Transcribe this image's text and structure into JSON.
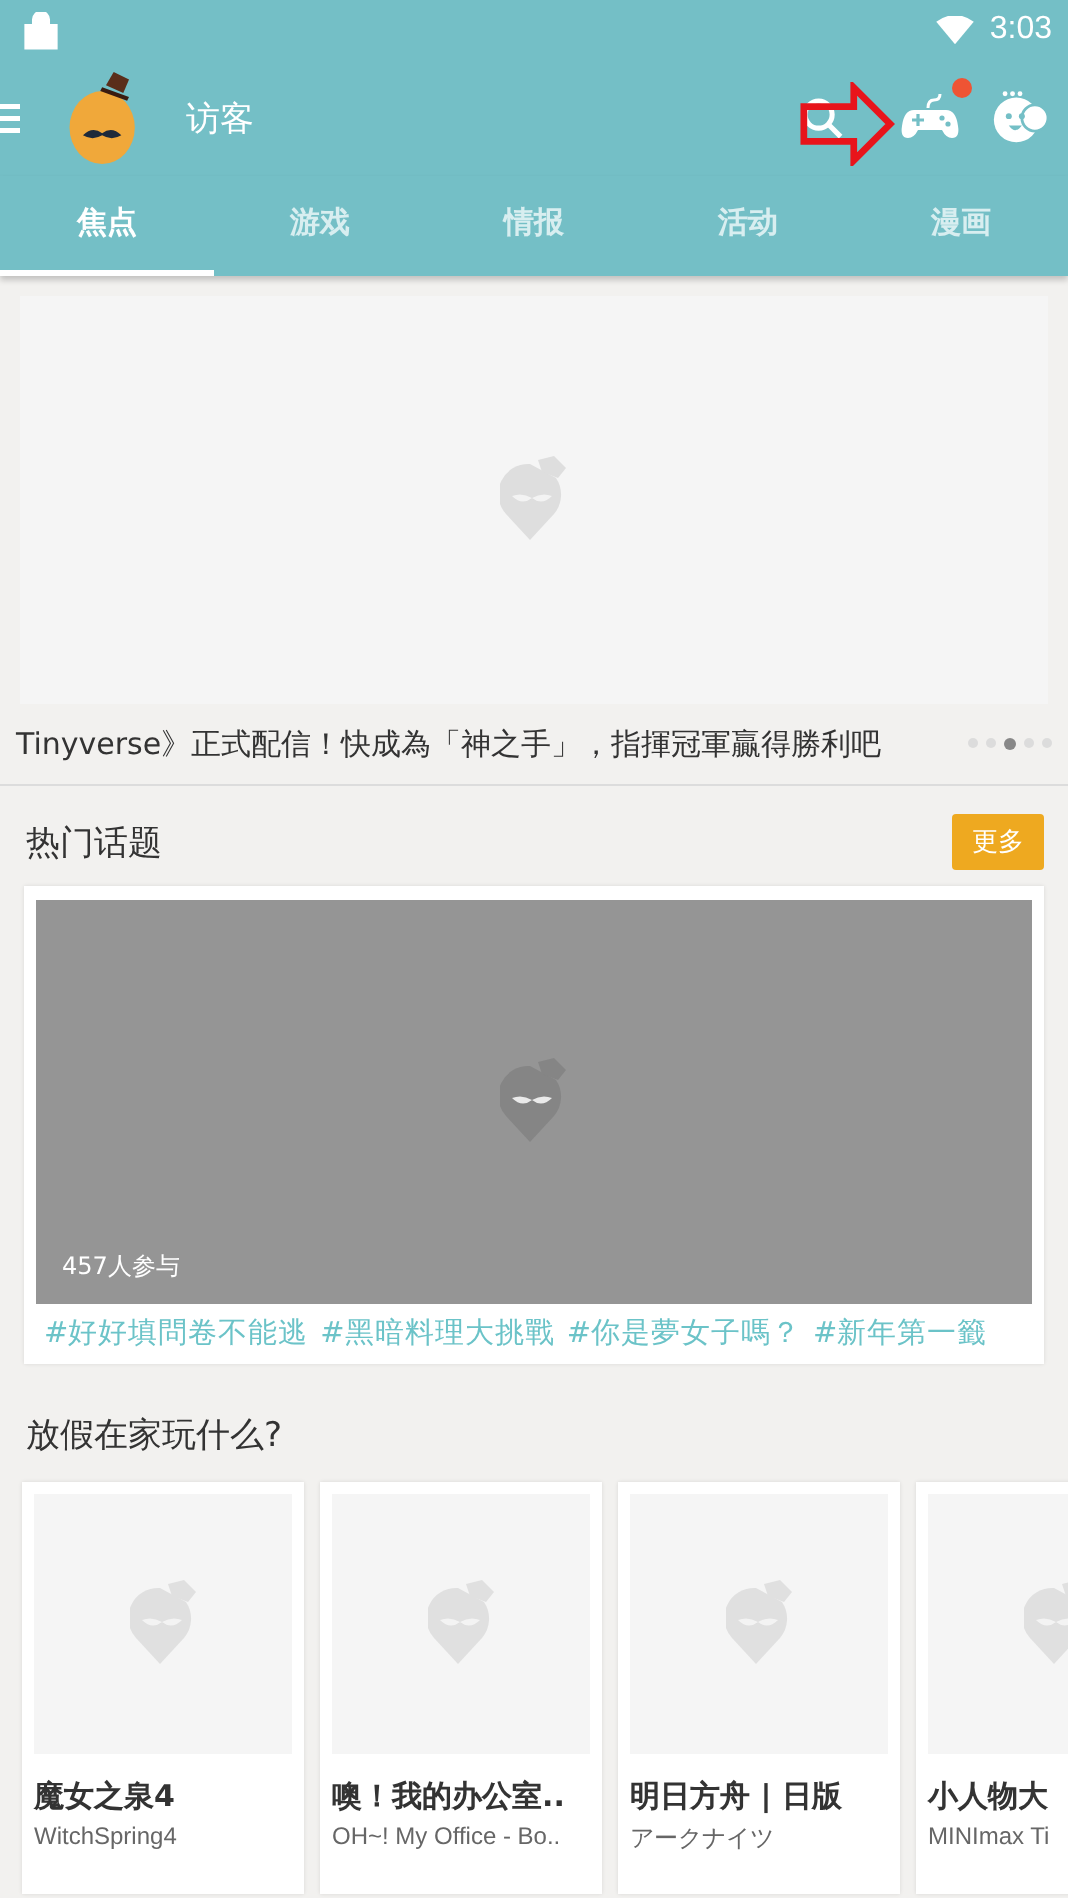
{
  "status_bar": {
    "time": "3:03"
  },
  "header": {
    "user_name": "访客",
    "game_badge": true
  },
  "tabs": [
    {
      "label": "焦点",
      "selected": true
    },
    {
      "label": "游戏",
      "selected": false
    },
    {
      "label": "情报",
      "selected": false
    },
    {
      "label": "活动",
      "selected": false
    },
    {
      "label": "漫画",
      "selected": false
    }
  ],
  "banner": {
    "caption": "Tinyverse》正式配信！快成為「神之手」，指揮冠軍贏得勝利吧",
    "dots": [
      {
        "selected": false
      },
      {
        "selected": false
      },
      {
        "selected": true
      },
      {
        "selected": false
      },
      {
        "selected": false
      }
    ]
  },
  "hot_topics": {
    "title": "热门话题",
    "more_button": "更多",
    "participants": "457人参与",
    "tags": [
      "#好好填問卷不能逃",
      "#黑暗料理大挑戰",
      "#你是夢女子嗎？",
      "#新年第一籤"
    ]
  },
  "holiday": {
    "title": "放假在家玩什么?",
    "games": [
      {
        "title": "魔女之泉4",
        "subtitle": "WitchSpring4"
      },
      {
        "title": "噢！我的办公室..",
        "subtitle": "OH~! My Office - Bo.."
      },
      {
        "title": "明日方舟 | 日版",
        "subtitle": "アークナイツ"
      },
      {
        "title": "小人物大",
        "subtitle": "MINImax Ti"
      }
    ]
  }
}
